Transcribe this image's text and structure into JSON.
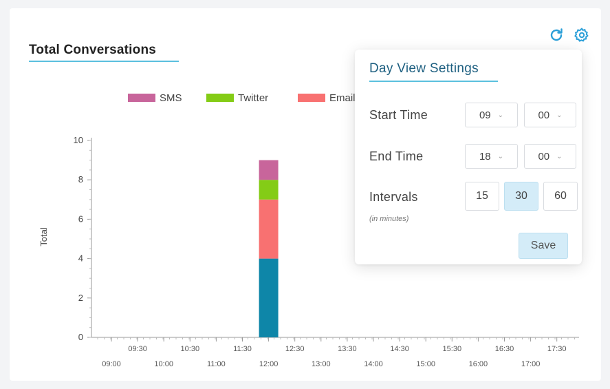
{
  "card": {
    "title": "Total Conversations"
  },
  "toolbar": {
    "refresh_icon": "refresh-icon",
    "settings_icon": "gear-icon",
    "accent": "#2b9fd8"
  },
  "chart_data": {
    "type": "bar",
    "stacked": true,
    "ylabel": "Total",
    "ylim": [
      0,
      10
    ],
    "yticks": [
      "0",
      "2",
      "4",
      "6",
      "8",
      "10"
    ],
    "x_row1": [
      "09:30",
      "10:30",
      "11:30",
      "12:30",
      "13:30",
      "14:30",
      "15:30",
      "16:30",
      "17:30"
    ],
    "x_row2": [
      "09:00",
      "10:00",
      "11:00",
      "12:00",
      "13:00",
      "14:00",
      "15:00",
      "16:00",
      "17:00"
    ],
    "bar_time": "12:00",
    "series": [
      {
        "name": "SMS",
        "color": "#c8659b",
        "value": 1
      },
      {
        "name": "Twitter",
        "color": "#84cc16",
        "value": 1
      },
      {
        "name": "Email",
        "color": "#f87171",
        "value": 3
      },
      {
        "name": "",
        "color": "#0e86a8",
        "value": 4
      }
    ],
    "legend_position": "top"
  },
  "popup": {
    "title": "Day View Settings",
    "start_label": "Start Time",
    "start_hour": "09",
    "start_minute": "00",
    "end_label": "End Time",
    "end_hour": "18",
    "end_minute": "00",
    "intervals_label": "Intervals",
    "intervals_sub": "(in minutes)",
    "intervals": [
      "15",
      "30",
      "60"
    ],
    "active_interval": "30",
    "save_label": "Save",
    "chevron_icon": "chevron-down-icon"
  }
}
